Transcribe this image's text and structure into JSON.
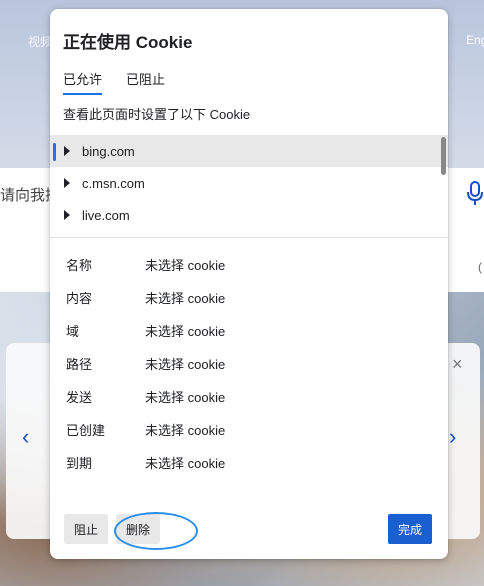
{
  "background": {
    "nav_left_text": "视频",
    "nav_right_text": "Eng",
    "search_hint": "请向我搜",
    "small_text": "(",
    "left_arrow": "‹",
    "right_arrow": "›",
    "close_glyph": "×"
  },
  "dialog": {
    "title": "正在使用 Cookie",
    "tabs": [
      {
        "label": "已允许",
        "active": true
      },
      {
        "label": "已阻止",
        "active": false
      }
    ],
    "description": "查看此页面时设置了以下 Cookie",
    "domains": [
      {
        "name": "bing.com",
        "selected": true
      },
      {
        "name": "c.msn.com",
        "selected": false
      },
      {
        "name": "live.com",
        "selected": false
      }
    ],
    "properties": [
      {
        "label": "名称",
        "value": "未选择 cookie"
      },
      {
        "label": "内容",
        "value": "未选择 cookie"
      },
      {
        "label": "域",
        "value": "未选择 cookie"
      },
      {
        "label": "路径",
        "value": "未选择 cookie"
      },
      {
        "label": "发送",
        "value": "未选择 cookie"
      },
      {
        "label": "已创建",
        "value": "未选择 cookie"
      },
      {
        "label": "到期",
        "value": "未选择 cookie"
      }
    ],
    "buttons": {
      "block": "阻止",
      "delete": "删除",
      "done": "完成"
    }
  },
  "colors": {
    "accent": "#1a73e8",
    "primary_button": "#1a5fd0",
    "highlight": "#2a8ee8"
  }
}
